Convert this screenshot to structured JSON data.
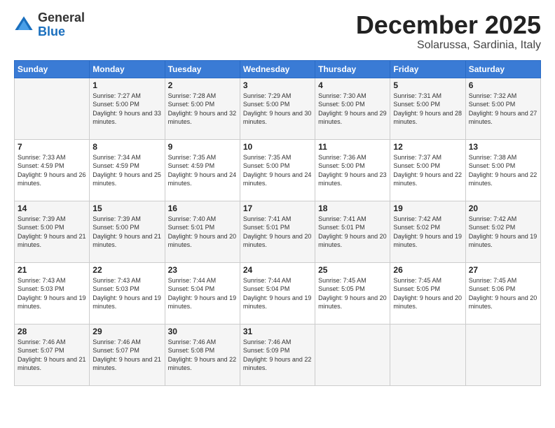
{
  "logo": {
    "general": "General",
    "blue": "Blue"
  },
  "header": {
    "month": "December 2025",
    "location": "Solarussa, Sardinia, Italy"
  },
  "weekdays": [
    "Sunday",
    "Monday",
    "Tuesday",
    "Wednesday",
    "Thursday",
    "Friday",
    "Saturday"
  ],
  "weeks": [
    [
      {
        "day": "",
        "sunrise": "",
        "sunset": "",
        "daylight": ""
      },
      {
        "day": "1",
        "sunrise": "7:27 AM",
        "sunset": "5:00 PM",
        "daylight": "9 hours and 33 minutes."
      },
      {
        "day": "2",
        "sunrise": "7:28 AM",
        "sunset": "5:00 PM",
        "daylight": "9 hours and 32 minutes."
      },
      {
        "day": "3",
        "sunrise": "7:29 AM",
        "sunset": "5:00 PM",
        "daylight": "9 hours and 30 minutes."
      },
      {
        "day": "4",
        "sunrise": "7:30 AM",
        "sunset": "5:00 PM",
        "daylight": "9 hours and 29 minutes."
      },
      {
        "day": "5",
        "sunrise": "7:31 AM",
        "sunset": "5:00 PM",
        "daylight": "9 hours and 28 minutes."
      },
      {
        "day": "6",
        "sunrise": "7:32 AM",
        "sunset": "5:00 PM",
        "daylight": "9 hours and 27 minutes."
      }
    ],
    [
      {
        "day": "7",
        "sunrise": "7:33 AM",
        "sunset": "4:59 PM",
        "daylight": "9 hours and 26 minutes."
      },
      {
        "day": "8",
        "sunrise": "7:34 AM",
        "sunset": "4:59 PM",
        "daylight": "9 hours and 25 minutes."
      },
      {
        "day": "9",
        "sunrise": "7:35 AM",
        "sunset": "4:59 PM",
        "daylight": "9 hours and 24 minutes."
      },
      {
        "day": "10",
        "sunrise": "7:35 AM",
        "sunset": "5:00 PM",
        "daylight": "9 hours and 24 minutes."
      },
      {
        "day": "11",
        "sunrise": "7:36 AM",
        "sunset": "5:00 PM",
        "daylight": "9 hours and 23 minutes."
      },
      {
        "day": "12",
        "sunrise": "7:37 AM",
        "sunset": "5:00 PM",
        "daylight": "9 hours and 22 minutes."
      },
      {
        "day": "13",
        "sunrise": "7:38 AM",
        "sunset": "5:00 PM",
        "daylight": "9 hours and 22 minutes."
      }
    ],
    [
      {
        "day": "14",
        "sunrise": "7:39 AM",
        "sunset": "5:00 PM",
        "daylight": "9 hours and 21 minutes."
      },
      {
        "day": "15",
        "sunrise": "7:39 AM",
        "sunset": "5:00 PM",
        "daylight": "9 hours and 21 minutes."
      },
      {
        "day": "16",
        "sunrise": "7:40 AM",
        "sunset": "5:01 PM",
        "daylight": "9 hours and 20 minutes."
      },
      {
        "day": "17",
        "sunrise": "7:41 AM",
        "sunset": "5:01 PM",
        "daylight": "9 hours and 20 minutes."
      },
      {
        "day": "18",
        "sunrise": "7:41 AM",
        "sunset": "5:01 PM",
        "daylight": "9 hours and 20 minutes."
      },
      {
        "day": "19",
        "sunrise": "7:42 AM",
        "sunset": "5:02 PM",
        "daylight": "9 hours and 19 minutes."
      },
      {
        "day": "20",
        "sunrise": "7:42 AM",
        "sunset": "5:02 PM",
        "daylight": "9 hours and 19 minutes."
      }
    ],
    [
      {
        "day": "21",
        "sunrise": "7:43 AM",
        "sunset": "5:03 PM",
        "daylight": "9 hours and 19 minutes."
      },
      {
        "day": "22",
        "sunrise": "7:43 AM",
        "sunset": "5:03 PM",
        "daylight": "9 hours and 19 minutes."
      },
      {
        "day": "23",
        "sunrise": "7:44 AM",
        "sunset": "5:04 PM",
        "daylight": "9 hours and 19 minutes."
      },
      {
        "day": "24",
        "sunrise": "7:44 AM",
        "sunset": "5:04 PM",
        "daylight": "9 hours and 19 minutes."
      },
      {
        "day": "25",
        "sunrise": "7:45 AM",
        "sunset": "5:05 PM",
        "daylight": "9 hours and 20 minutes."
      },
      {
        "day": "26",
        "sunrise": "7:45 AM",
        "sunset": "5:05 PM",
        "daylight": "9 hours and 20 minutes."
      },
      {
        "day": "27",
        "sunrise": "7:45 AM",
        "sunset": "5:06 PM",
        "daylight": "9 hours and 20 minutes."
      }
    ],
    [
      {
        "day": "28",
        "sunrise": "7:46 AM",
        "sunset": "5:07 PM",
        "daylight": "9 hours and 21 minutes."
      },
      {
        "day": "29",
        "sunrise": "7:46 AM",
        "sunset": "5:07 PM",
        "daylight": "9 hours and 21 minutes."
      },
      {
        "day": "30",
        "sunrise": "7:46 AM",
        "sunset": "5:08 PM",
        "daylight": "9 hours and 22 minutes."
      },
      {
        "day": "31",
        "sunrise": "7:46 AM",
        "sunset": "5:09 PM",
        "daylight": "9 hours and 22 minutes."
      },
      {
        "day": "",
        "sunrise": "",
        "sunset": "",
        "daylight": ""
      },
      {
        "day": "",
        "sunrise": "",
        "sunset": "",
        "daylight": ""
      },
      {
        "day": "",
        "sunrise": "",
        "sunset": "",
        "daylight": ""
      }
    ]
  ]
}
